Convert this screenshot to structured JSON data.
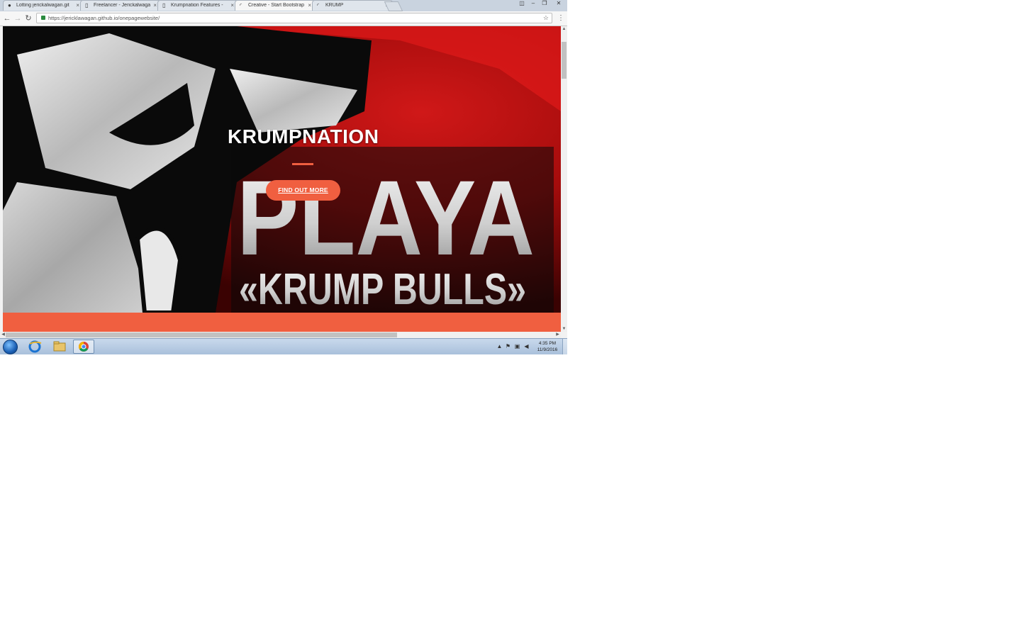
{
  "browser": {
    "tabs": [
      {
        "title": "Lotting jerickalwagan.git",
        "favicon": "github-icon",
        "active": false
      },
      {
        "title": "Freelancer - Jerickalwagan",
        "favicon": "page-icon",
        "active": false
      },
      {
        "title": "Krumpnation Features -",
        "favicon": "page-icon",
        "active": false
      },
      {
        "title": "Creative - Start Bootstrap",
        "favicon": "loading-icon",
        "active": true
      },
      {
        "title": "KRUMP",
        "favicon": "loading-icon",
        "active": false
      }
    ],
    "url": "https://jericklawagan.github.io/onepagewebsite/",
    "accent": "#f05f40"
  },
  "hero": {
    "title": "KRUMPNATION",
    "cta_label": "FIND OUT MORE",
    "image_text_line1": "PLAYA",
    "image_text_line2": "«KRUMP BULLS»"
  },
  "taskbar": {
    "time": "4:35 PM",
    "date": "11/9/2016"
  }
}
